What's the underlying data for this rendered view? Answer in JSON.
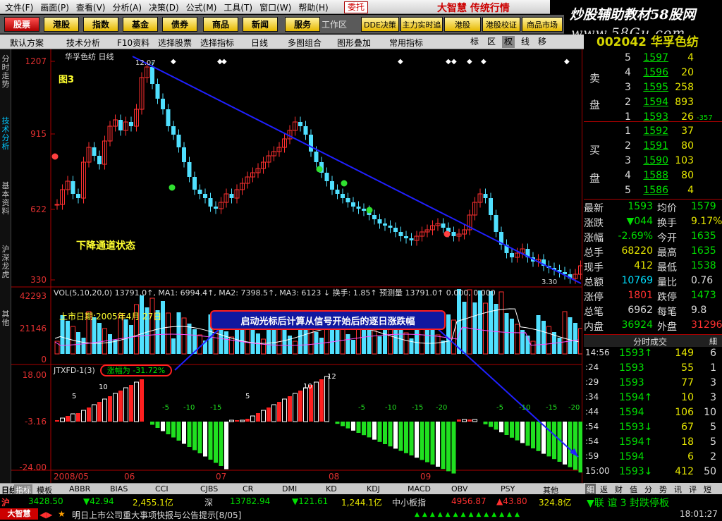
{
  "menubar": {
    "items": [
      "文件(F)",
      "画面(P)",
      "查看(V)",
      "分析(A)",
      "决策(D)",
      "公式(M)",
      "工具(T)",
      "窗口(W)",
      "帮助(H)"
    ],
    "entrust": "委托",
    "brand": "大智慧 传统行情"
  },
  "banner": {
    "title": "炒股辅助教材58股网",
    "url": "www.58Gu.com"
  },
  "toolbar": {
    "buttons": [
      "股票",
      "港股",
      "指数",
      "基金",
      "债券",
      "商品",
      "新闻",
      "服务"
    ],
    "work_area": "工作区",
    "right_buttons": [
      "DDE决策",
      "主力实时追",
      "港股",
      "港股校证",
      "商品市场"
    ]
  },
  "toolbar2": {
    "items": [
      "默认方案",
      "技术分析",
      "F10资料",
      "选择股票",
      "选择指标",
      "日线",
      "多图组合",
      "图形叠加",
      "常用指标"
    ],
    "icons": [
      "标",
      "区",
      "权",
      "线",
      "移"
    ]
  },
  "left_tabs": [
    "分时走势",
    "技术分析",
    "基本资料",
    "沪深龙虎",
    "其他"
  ],
  "stock_header": "002042 华孚色纺",
  "main_chart": {
    "title": "华孚色纺 日线",
    "fig_label": "图3",
    "note": "下降通道状态",
    "peak_label": "12.07",
    "low_label": "3.30",
    "y_ticks": [
      "1207",
      "915",
      "622",
      "330"
    ]
  },
  "volume": {
    "info": "VOL(5,10,20,0)  13791.0↑, MA1: 6994.4↑, MA2: 7398.5↑, MA3: 6123 ↓  换手: 1.85↑  预测量  13791.0↑  0.000, 0.000",
    "listing": "上市日期:2005年4月 27日",
    "y_ticks": [
      "42293",
      "21146",
      "0"
    ]
  },
  "indicator": {
    "info": "JTXFD-1(3)",
    "badge": "涨幅为 -31.72%",
    "y_ticks": [
      "18.00",
      "-3.16",
      "-24.00"
    ],
    "neg_labels": [
      "-5",
      "-10",
      "-15",
      "-20"
    ],
    "pos_labels": [
      "5",
      "10",
      "12"
    ]
  },
  "annotation": "启动光标后计算从信号开始后的逐日涨跌幅",
  "date_axis": [
    "2008/05",
    "06",
    "07",
    "08",
    "09"
  ],
  "bottom_tabs": [
    "日线",
    "指标",
    "模板",
    "ABBR",
    "BIAS",
    "CCI",
    "CJBS",
    "CR",
    "DMI",
    "KD",
    "KDJ",
    "MACD",
    "OBV",
    "PSY",
    "其他"
  ],
  "orderbook": {
    "sell_label": [
      "卖",
      "盘"
    ],
    "buy_label": [
      "买",
      "盘"
    ],
    "sell": [
      {
        "idx": "5",
        "price": "1597",
        "vol": "4"
      },
      {
        "idx": "4",
        "price": "1596",
        "vol": "20"
      },
      {
        "idx": "3",
        "price": "1595",
        "vol": "258"
      },
      {
        "idx": "2",
        "price": "1594",
        "vol": "893"
      },
      {
        "idx": "1",
        "price": "1593",
        "vol": "26",
        "extra": "-357"
      }
    ],
    "buy": [
      {
        "idx": "1",
        "price": "1592",
        "vol": "37"
      },
      {
        "idx": "2",
        "price": "1591",
        "vol": "80"
      },
      {
        "idx": "3",
        "price": "1590",
        "vol": "103"
      },
      {
        "idx": "4",
        "price": "1588",
        "vol": "80"
      },
      {
        "idx": "5",
        "price": "1586",
        "vol": "4"
      }
    ]
  },
  "quote": [
    {
      "l1": "最新",
      "v1": "1593",
      "c1": "#00e000",
      "l2": "均价",
      "v2": "1579",
      "c2": "#00e000"
    },
    {
      "l1": "涨跌",
      "v1": "▼044",
      "c1": "#00e000",
      "l2": "换手",
      "v2": "9.17%",
      "c2": "#e6e600"
    },
    {
      "l1": "涨幅",
      "v1": "-2.69%",
      "c1": "#00e000",
      "l2": "今开",
      "v2": "1635",
      "c2": "#00e000"
    },
    {
      "l1": "总手",
      "v1": "68220",
      "c1": "#e6e600",
      "l2": "最高",
      "v2": "1635",
      "c2": "#00e000"
    },
    {
      "l1": "现手",
      "v1": "412",
      "c1": "#e6e600",
      "l2": "最低",
      "v2": "1538",
      "c2": "#00e000"
    },
    {
      "l1": "总额",
      "v1": "10769",
      "c1": "#00e0ff",
      "l2": "量比",
      "v2": "0.76",
      "c2": "#ddd"
    },
    {
      "l1": "涨停",
      "v1": "1801",
      "c1": "#ff3030",
      "l2": "跌停",
      "v2": "1473",
      "c2": "#00e000"
    },
    {
      "l1": "总笔",
      "v1": "6962",
      "c1": "#ddd",
      "l2": "每笔",
      "v2": "9.8",
      "c2": "#ddd"
    },
    {
      "l1": "内盘",
      "v1": "36924",
      "c1": "#00e000",
      "l2": "外盘",
      "v2": "31296",
      "c2": "#ff3030"
    }
  ],
  "ticks_header": {
    "title": "分时成交",
    "right": "細"
  },
  "ticks": [
    {
      "t": "14:56",
      "p": "1593↑",
      "v": "149",
      "n": "6"
    },
    {
      "t": ":24",
      "p": "1593",
      "v": "55",
      "n": "1"
    },
    {
      "t": ":29",
      "p": "1593",
      "v": "77",
      "n": "3"
    },
    {
      "t": ":34",
      "p": "1594↑",
      "v": "10",
      "n": "3"
    },
    {
      "t": ":44",
      "p": "1594",
      "v": "106",
      "n": "10"
    },
    {
      "t": ":54",
      "p": "1593↓",
      "v": "67",
      "n": "5"
    },
    {
      "t": ":54",
      "p": "1594↑",
      "v": "18",
      "n": "5"
    },
    {
      "t": ":59",
      "p": "1594",
      "v": "6",
      "n": "2"
    },
    {
      "t": "15:00",
      "p": "1593↓",
      "v": "412",
      "n": "50"
    }
  ],
  "right_tabs": [
    "细",
    "返",
    "财",
    "值",
    "分",
    "势",
    "讯",
    "评",
    "短"
  ],
  "status": {
    "sh_label": "沪",
    "sh_index": "3428.50",
    "sh_chg": "▼42.94",
    "sh_amt": "2,455.1亿",
    "sz_label": "深",
    "sz_index": "13782.94",
    "sz_chg": "▼121.61",
    "sz_amt": "1,244.1亿",
    "sme_label": "中小板指",
    "sme_index": "4956.87",
    "sme_chg": "▲43.80",
    "sme_amt": "324.8亿",
    "ticker": "▼联 谊 3 封跌停板",
    "news": "明日上市公司重大事项快报与公告提示[8/05]",
    "clock": "18:01:27",
    "logo": "大智慧"
  }
}
